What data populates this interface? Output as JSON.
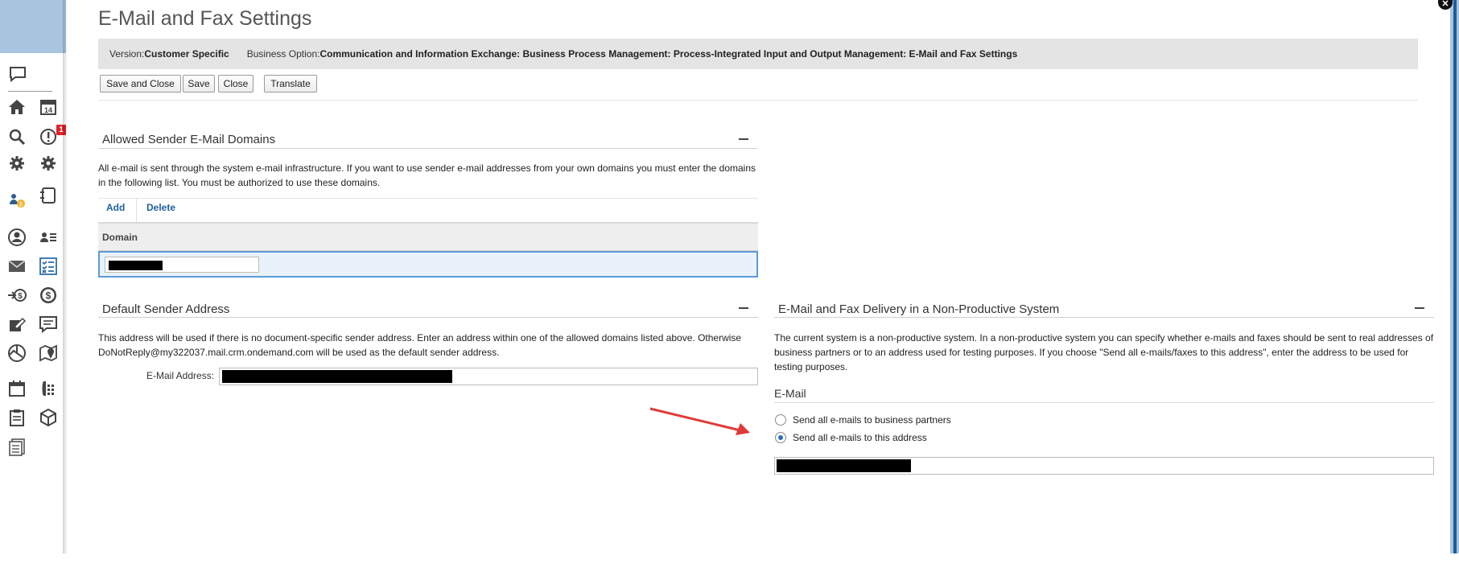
{
  "page_title": "E-Mail and Fax Settings",
  "close_icon": "close-icon",
  "info_bar": {
    "version_label": "Version:",
    "version_value": "Customer Specific",
    "business_option_label": "Business Option:",
    "business_option_value": "Communication and Information Exchange: Business Process Management: Process-Integrated Input and Output Management: E-Mail and Fax Settings"
  },
  "toolbar": {
    "save_and_close": "Save and Close",
    "save": "Save",
    "close": "Close",
    "translate": "Translate"
  },
  "rail": {
    "badge_count": "1",
    "icons": [
      "feedback-icon",
      "home-icon",
      "calendar-icon",
      "search-icon",
      "alert-icon",
      "settings-icon",
      "settings-alt-icon",
      "people-money-icon",
      "notebook-icon",
      "account-icon",
      "contacts-list-icon",
      "mail-icon",
      "checklist-icon",
      "money-in-icon",
      "dollar-icon",
      "pencil-doc-icon",
      "chat-icon",
      "analytics-icon",
      "map-icon",
      "schedule-icon",
      "phone-icon",
      "clipboard-icon",
      "cube-icon",
      "documents-icon"
    ]
  },
  "allowed_domains": {
    "title": "Allowed Sender E-Mail Domains",
    "description": "All e-mail is sent through the system e-mail infrastructure. If you want to use sender e-mail addresses from your own domains you must enter the domains in the following list. You must be authorized to use these domains.",
    "add_label": "Add",
    "delete_label": "Delete",
    "column_domain": "Domain"
  },
  "default_sender": {
    "title": "Default Sender Address",
    "description": "This address will be used if there is no document-specific sender address. Enter an address within one of the allowed domains listed above. Otherwise DoNotReply@my322037.mail.crm.ondemand.com will be used as the default sender address.",
    "email_label": "E-Mail Address:"
  },
  "delivery": {
    "title": "E-Mail and Fax Delivery in a Non-Productive System",
    "description": "The current system is a non-productive system. In a non-productive system you can specify whether e-mails and faxes should be sent to real addresses of business partners or to an address used for testing purposes. If you choose \"Send all e-mails/faxes to this address\", enter the address to be used for testing purposes.",
    "email_heading": "E-Mail",
    "option_partners": "Send all e-mails to business partners",
    "option_address": "Send all e-mails to this address",
    "selected_option": "Send all e-mails to this address"
  },
  "colors": {
    "accent_blue": "#1f5f9f",
    "rail_bg": "#a9c4de",
    "annotation_arrow": "#e03a3a",
    "badge_red": "#e2202a"
  }
}
